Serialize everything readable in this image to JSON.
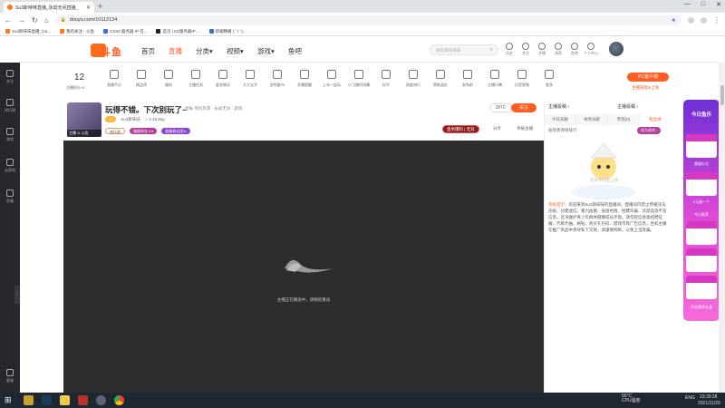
{
  "browser": {
    "tab_title": "Su3斯味味直播_永劫无间直播_",
    "url": "douyu.com/10112134",
    "bookmarks": [
      "Su3斯味味直播_CS...",
      "我的关注 - 斗鱼",
      "CSX2 服务器 IP 在...",
      "首页 | KZ服务器IP ...",
      "新端释播 ( ' !: ')..."
    ],
    "window_controls": [
      "—",
      "□",
      "✕"
    ]
  },
  "site": {
    "logo_text": "斗鱼",
    "nav": [
      "首页",
      "直播",
      "分类▾",
      "视频▾",
      "游戏▾",
      "鱼吧"
    ],
    "nav_active": 1,
    "search_placeholder": "你的海的海味",
    "header_icons": [
      "历史",
      "关注",
      "开播",
      "消息",
      "鱼吧",
      "个人中心"
    ]
  },
  "left_sidebar": [
    "关注",
    "排行榜",
    "游戏",
    "云游戏",
    "鱼塘",
    "客服"
  ],
  "toolbar": {
    "level": "12",
    "level_label": "主播积分 ⊘",
    "items": [
      "直播平分",
      "精品榜",
      "福利",
      "主播任务",
      "要求情况",
      "大大全开",
      "全明星PK",
      "开播提醒",
      "上车一起玩",
      "小飞猪时间爆",
      "好评",
      "热度排行",
      "赞助战队",
      "发布前",
      "主播口碑",
      "抖音视频",
      "更多"
    ],
    "pc_button": "PC客户端",
    "pc_sub": "主播技能&上线"
  },
  "room": {
    "title": "玩得不错。下次别玩了~",
    "tags": "举报  单机热游 · 永劫无间 · 游戏",
    "streamer_name": "Su3斯味味",
    "streamer_meta": "♀ 0   45.6kg",
    "thumb_label": "主播   ⊙ 公告",
    "badge1": "快乐星",
    "badge2": "福星粉丝 0 ▸",
    "badge3": "超级粉丝团 ▸",
    "rank": "直男爆料 | 无双",
    "follow_count": "3870",
    "follow": "关注",
    "share": "分享",
    "complain": "举报主播"
  },
  "player": {
    "offline_text": "主播正在路途中，请稍后重试"
  },
  "chat": {
    "header_left": "主播投稿 ›",
    "header_right": "主播投稿 ›",
    "tabs": [
      "今日贡献",
      "本周贡献",
      "贵宾(0)",
      "粉丝榜"
    ],
    "hour_rank_label": "按周贵宾榜排行",
    "hour_rank_btn": "成为贵宾 ›",
    "hint": "还未有粉丝上榜",
    "sys_label": "系统提示：",
    "sys_text": "欢迎来到Su3斯味味的直播间，直播间内禁止传播违法违规、封建迷信、暴力血腥、低俗色情、招嫖诈骗、违禁品等不良信息，坚决维护青少年群体健康成长环境。请勿轻信各类招聘征婚、代练代抽、刷钻、购买礼包码、游戏币等广告信息，且如主播在推广商品中诱导私下交易，请谨慎判断，以免上当受骗。"
  },
  "promo": {
    "title": "今日鱼乐",
    "labels": [
      "超值礼包",
      "0元抽一个",
      "开启礼盒",
      "今日推荐",
      "小车多了",
      "大航海",
      "开启赛季礼盒"
    ]
  },
  "taskbar": {
    "temp": "56°C\nCPU温度",
    "lang": "ENG",
    "time": "23:39:28",
    "date": "2021/11/29"
  },
  "colors": {
    "accent": "#ff5d23",
    "dark_sidebar": "#27282c",
    "player_bg": "#2d2d2f",
    "promo_purple": "#6e2fd6"
  }
}
